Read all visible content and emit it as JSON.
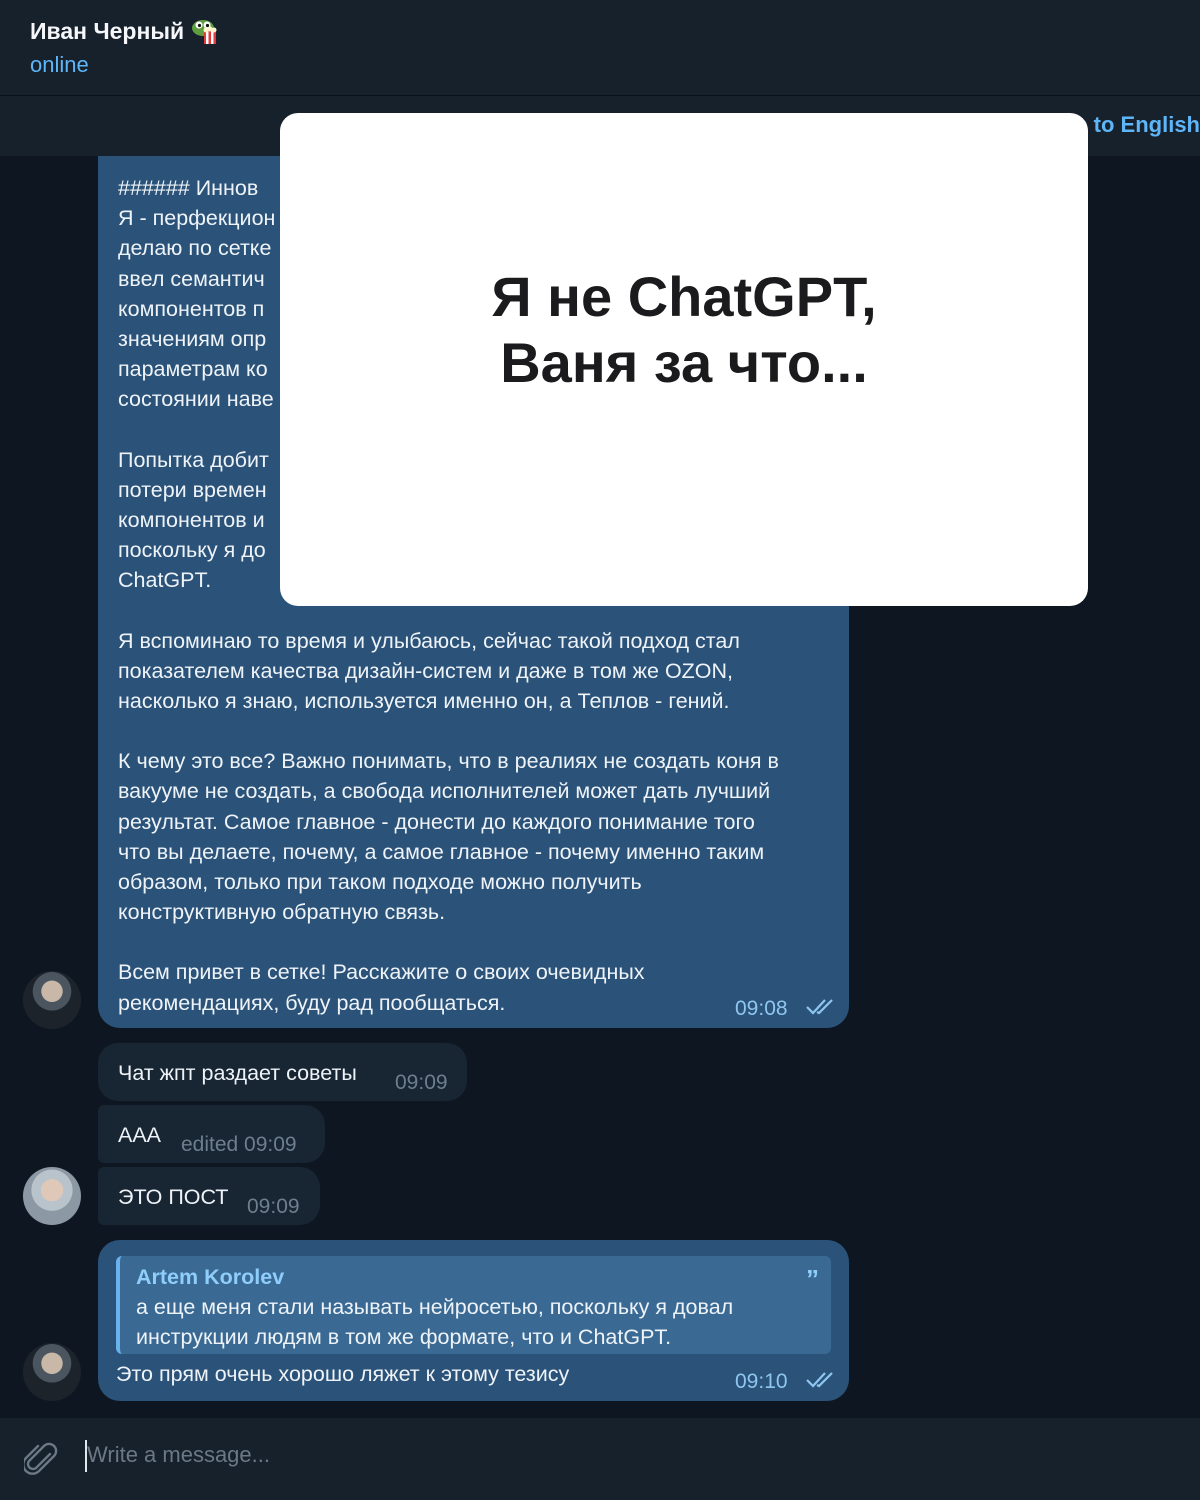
{
  "header": {
    "contact_name": "Иван Черный",
    "status": "online",
    "emoji_icon": "pepe-frog-popcorn-icon"
  },
  "translate_bar": {
    "label": "e to English"
  },
  "overlay": {
    "line1": "Я не ChatGPT,",
    "line2": "Ваня за что..."
  },
  "messages": {
    "long_post": {
      "p1": "###### Иннов\nЯ - перфекцион\nделаю по сетке\nввел семантич\nкомпонентов п\nзначениям опр\nпараметрам ко\nсостоянии наве",
      "p2": "Попытка добит\nпотери времен\nкомпонентов и\nпоскольку я до\nChatGPT.",
      "p3": "Я вспоминаю то время и улыбаюсь, сейчас такой подход стал\nпоказателем качества дизайн-систем и даже в том же OZON,\nнасколько я знаю, используется именно он, а Теплов - гений.",
      "p4": "К чему это все? Важно понимать, что в реалиях не создать коня в\nвакууме не создать, а свобода исполнителей может дать лучший\nрезультат. Самое главное - донести до каждого понимание того\nчто вы делаете, почему, а самое главное - почему именно таким\nобразом, только при таком подходе можно получить\nконструктивную обратную связь.",
      "p5": "Всем привет в сетке! Расскажите о своих очевидных\nрекомендациях, буду рад пообщаться.",
      "time": "09:08"
    },
    "in1": {
      "text": "Чат жпт раздает советы",
      "time": "09:09"
    },
    "in2": {
      "text": "ААА",
      "time": "edited 09:09"
    },
    "in3": {
      "text": "ЭТО ПОСТ",
      "time": "09:09"
    },
    "reply": {
      "quote_author": "Artem Korolev",
      "quote_text": "а еще меня стали называть нейросетью, поскольку я довал\nинструкции людям в том же формате, что и ChatGPT.",
      "text": "Это прям очень хорошо ляжет к этому тезису",
      "time": "09:10"
    }
  },
  "composer": {
    "placeholder": "Write a message..."
  },
  "colors": {
    "background": "#0e1621",
    "header": "#17212b",
    "outgoing_bubble": "#2b5278",
    "incoming_bubble": "#182533",
    "accent": "#5eb5f7"
  }
}
